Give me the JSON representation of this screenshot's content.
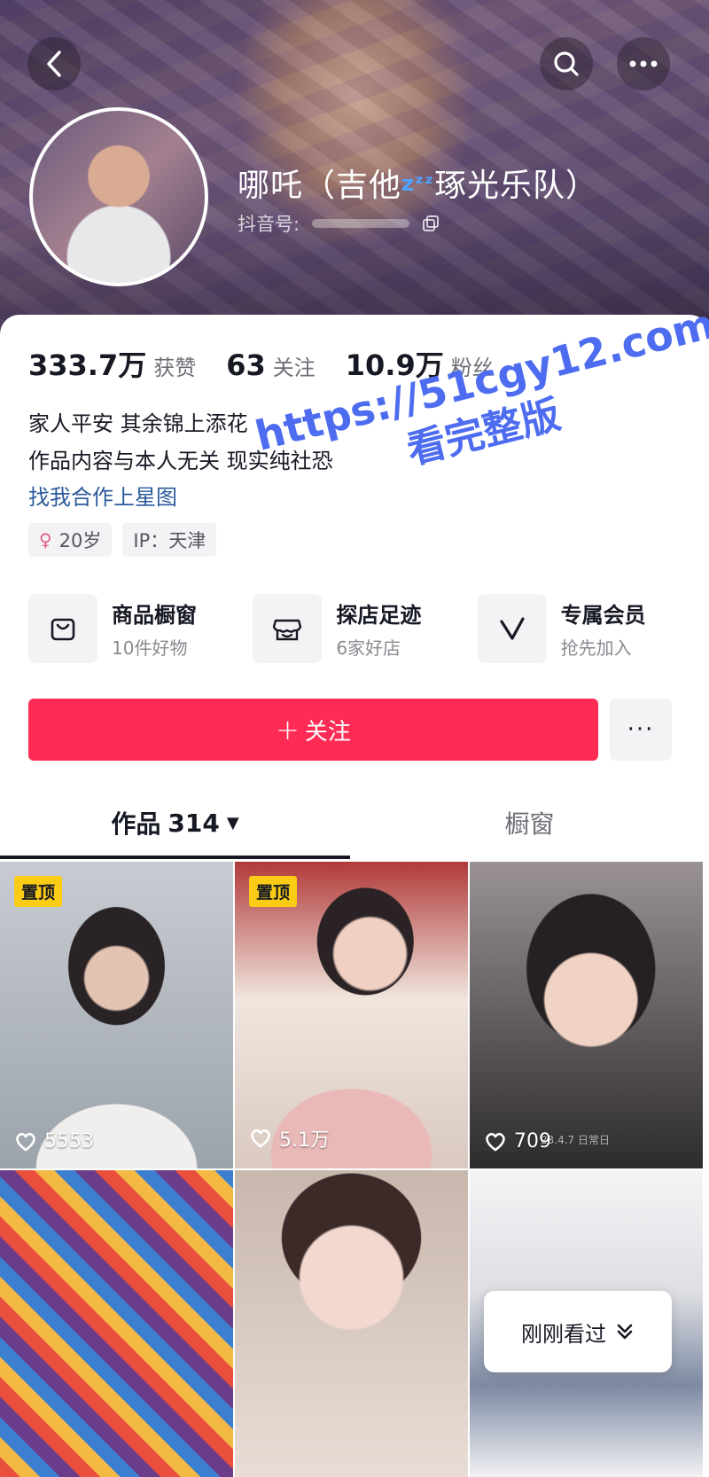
{
  "profile": {
    "name_part1": "哪吒（吉他",
    "name_zzz": "zᶻᶻ",
    "name_part2": "琢光乐队）",
    "douyin_id_label": "抖音号:"
  },
  "stats": [
    {
      "value": "333.7万",
      "label": "获赞"
    },
    {
      "value": "63",
      "label": "关注"
    },
    {
      "value": "10.9万",
      "label": "粉丝"
    }
  ],
  "bio": {
    "line1": "家人平安 其余锦上添花",
    "line2": "作品内容与本人无关 现实纯社恐",
    "link": "找我合作上星图"
  },
  "tags": {
    "age": "20岁",
    "ip": "IP：天津"
  },
  "services": [
    {
      "icon": "shopping-bag-icon",
      "title": "商品橱窗",
      "sub": "10件好物"
    },
    {
      "icon": "shop-icon",
      "title": "探店足迹",
      "sub": "6家好店"
    },
    {
      "icon": "vip-v-icon",
      "title": "专属会员",
      "sub": "抢先加入"
    }
  ],
  "follow": {
    "plus": "+",
    "label": "关注",
    "more": "···"
  },
  "tabs": {
    "works_label": "作品",
    "works_count": "314",
    "window_label": "橱窗"
  },
  "grid": [
    {
      "pinned": true,
      "likes": "5553"
    },
    {
      "pinned": true,
      "likes": "5.1万"
    },
    {
      "pinned": false,
      "likes": "709",
      "date": "23.4.7 日常日"
    },
    {
      "pinned": false
    },
    {
      "pinned": false
    },
    {
      "pinned": false
    }
  ],
  "pin_label": "置顶",
  "recent": {
    "label": "刚刚看过"
  },
  "watermark": {
    "line1": "https://51cgy12.com",
    "line2": "看完整版"
  },
  "colors": {
    "follow": "#fe2c55",
    "link": "#2b5a9c",
    "pin": "#facc15",
    "watermark": "#4d6cf0"
  }
}
